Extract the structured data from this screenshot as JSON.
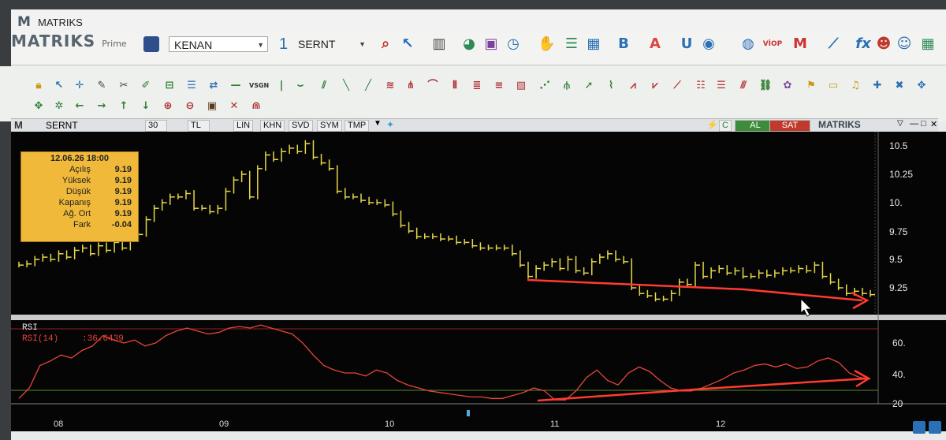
{
  "window": {
    "logo": "M",
    "title": "MATRIKS"
  },
  "toolbar": {
    "brand": "MATRIKS",
    "brand_sub": "Prime",
    "user_combo": "KENAN",
    "layout_number": "1",
    "symbol_combo": "SERNT",
    "letters": {
      "bold": "B",
      "font": "A",
      "underline": "U",
      "viop": "VİOP",
      "fx": "fx"
    }
  },
  "chart_header": {
    "symbol": "SERNT",
    "period": "30",
    "currency": "TL",
    "buttons": [
      "LIN",
      "KHN",
      "SVD",
      "SYM",
      "TMP"
    ],
    "al": "AL",
    "sat": "SAT",
    "brand": "MATRIKS"
  },
  "infobox": {
    "date": "12.06.26 18:00",
    "rows": [
      {
        "label": "Açılış",
        "value": "9.19"
      },
      {
        "label": "Yüksek",
        "value": "9.19"
      },
      {
        "label": "Düşük",
        "value": "9.19"
      },
      {
        "label": "Kapanış",
        "value": "9.19"
      },
      {
        "label": "Ağ. Ort",
        "value": "9.19"
      },
      {
        "label": "Fark",
        "value": "-0.04"
      }
    ]
  },
  "rsi": {
    "title": "RSI",
    "series_label": "RSI(14)",
    "value": ":36.6439"
  },
  "colors": {
    "price_bars": "#e6d84a",
    "rsi_line": "#e8453a",
    "arrow": "#ff3b30",
    "infobox": "#f0b93a",
    "background": "#050505"
  },
  "chart_data": [
    {
      "type": "line",
      "subtype": "ohlc-step",
      "ylabel": "",
      "yticks": [
        "10.5",
        "10.25",
        "10.",
        "9.75",
        "9.5",
        "9.25"
      ],
      "ylim": [
        9.1,
        10.55
      ],
      "x_category_labels": [
        "08",
        "09",
        "10",
        "11",
        "12"
      ],
      "values": [
        9.45,
        9.46,
        9.5,
        9.52,
        9.5,
        9.55,
        9.52,
        9.58,
        9.6,
        9.55,
        9.62,
        9.58,
        9.65,
        9.6,
        9.68,
        9.72,
        9.85,
        9.95,
        10.0,
        10.05,
        10.05,
        10.08,
        9.95,
        9.95,
        9.92,
        9.95,
        10.1,
        10.2,
        10.25,
        10.05,
        10.3,
        10.42,
        10.38,
        10.45,
        10.48,
        10.45,
        10.52,
        10.4,
        10.35,
        10.3,
        10.1,
        10.05,
        10.05,
        10.02,
        10.0,
        10.0,
        9.98,
        9.9,
        9.8,
        9.75,
        9.7,
        9.7,
        9.7,
        9.68,
        9.68,
        9.65,
        9.65,
        9.62,
        9.6,
        9.6,
        9.6,
        9.6,
        9.55,
        9.45,
        9.35,
        9.42,
        9.45,
        9.48,
        9.42,
        9.5,
        9.4,
        9.38,
        9.48,
        9.52,
        9.55,
        9.5,
        9.48,
        9.25,
        9.2,
        9.18,
        9.15,
        9.15,
        9.2,
        9.3,
        9.28,
        9.45,
        9.35,
        9.4,
        9.42,
        9.38,
        9.4,
        9.35,
        9.35,
        9.38,
        9.36,
        9.38,
        9.4,
        9.4,
        9.42,
        9.4,
        9.45,
        9.35,
        9.3,
        9.25,
        9.2,
        9.22,
        9.2,
        9.19
      ],
      "trendline": {
        "from": 9.32,
        "to": 9.15
      }
    },
    {
      "type": "line",
      "title": "RSI",
      "series": [
        {
          "name": "RSI(14)"
        }
      ],
      "yticks": [
        "60.",
        "40.",
        "20"
      ],
      "ylim": [
        20,
        70
      ],
      "values": [
        23,
        30,
        45,
        48,
        52,
        50,
        55,
        58,
        65,
        62,
        60,
        62,
        58,
        60,
        65,
        68,
        70,
        68,
        66,
        67,
        70,
        71,
        70,
        72,
        70,
        68,
        66,
        60,
        52,
        45,
        42,
        40,
        40,
        38,
        42,
        40,
        35,
        32,
        30,
        28,
        27,
        26,
        25,
        24,
        24,
        23,
        23,
        25,
        27,
        30,
        28,
        22,
        22,
        28,
        37,
        42,
        35,
        32,
        40,
        44,
        41,
        35,
        30,
        28,
        28,
        30,
        33,
        36,
        40,
        42,
        45,
        46,
        44,
        46,
        43,
        44,
        48,
        50,
        47,
        40,
        37,
        36
      ]
    }
  ]
}
